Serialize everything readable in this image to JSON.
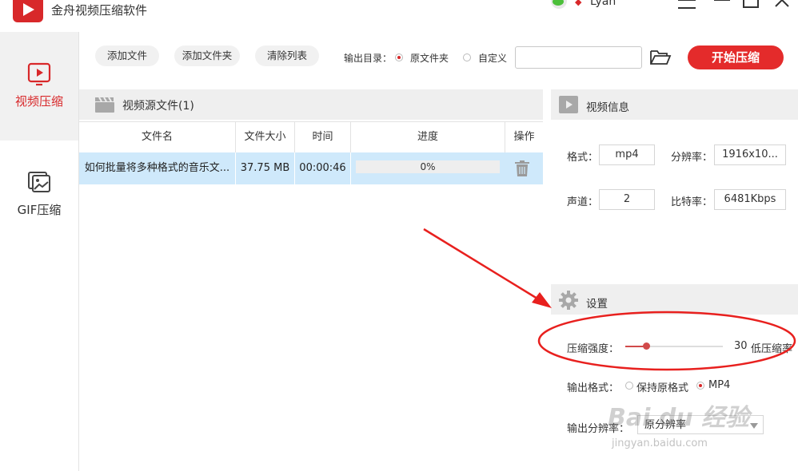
{
  "app": {
    "title": "金舟视频压缩软件",
    "user": "Lyan"
  },
  "sidebar": {
    "items": [
      {
        "label": "视频压缩",
        "active": true
      },
      {
        "label": "GIF压缩",
        "active": false
      }
    ]
  },
  "toolbar": {
    "add_file": "添加文件",
    "add_folder": "添加文件夹",
    "clear_list": "清除列表",
    "output_dir_label": "输出目录：",
    "option_original": "原文件夹",
    "option_custom": "自定义",
    "path_value": "",
    "start": "开始压缩"
  },
  "source": {
    "title": "视频源文件(1)",
    "columns": [
      "文件名",
      "文件大小",
      "时间",
      "进度",
      "操作"
    ],
    "rows": [
      {
        "name": "如何批量将多种格式的音乐文...",
        "size": "37.75 MB",
        "time": "00:00:46",
        "progress": "0%"
      }
    ]
  },
  "info": {
    "title": "视频信息",
    "format_label": "格式：",
    "format": "mp4",
    "resolution_label": "分辨率：",
    "resolution": "1916x10...",
    "channel_label": "声道：",
    "channel": "2",
    "bitrate_label": "比特率：",
    "bitrate": "6481Kbps"
  },
  "settings": {
    "title": "设置",
    "strength_label": "压缩强度：",
    "strength_value": "30",
    "strength_fraction": 0.22,
    "strength_desc": "低压缩率",
    "output_format_label": "输出格式：",
    "format_keep": "保持原格式",
    "format_mp4": "MP4",
    "output_res_label": "输出分辨率：",
    "output_res_value": "原分辨率"
  },
  "watermark": {
    "main": "Bai du 经验",
    "sub": "jingyan.baidu.com"
  },
  "colors": {
    "accent": "#e42b2b",
    "annotation": "#e8201e",
    "selected_row": "#cfe9fb"
  }
}
